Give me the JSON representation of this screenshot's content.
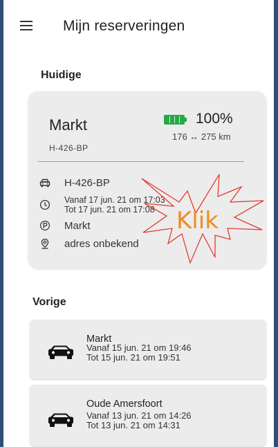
{
  "header": {
    "title": "Mijn reserveringen",
    "menu_icon": "hamburger-menu-icon"
  },
  "current": {
    "section_title": "Huidige",
    "location": "Markt",
    "plate": "H-426-BP",
    "battery_percent": "100%",
    "battery_level": 1.0,
    "battery_color": "#26a845",
    "range": "176 ↔ 275 km",
    "details": {
      "plate": "H-426-BP",
      "from": "Vanaf 17 jun. 21 om 17:03",
      "to": "Tot 17 jun. 21 om 17:08",
      "parking": "Markt",
      "address": "adres onbekend"
    },
    "annotation": "Klik",
    "annotation_color": "#f28a1e"
  },
  "previous": {
    "section_title": "Vorige",
    "items": [
      {
        "location": "Markt",
        "from": "Vanaf 15 jun. 21 om 19:46",
        "to": "Tot 15 jun. 21 om 19:51"
      },
      {
        "location": "Oude Amersfoort",
        "from": "Vanaf 13 jun. 21 om 14:26",
        "to": "Tot 13 jun. 21 om 14:31"
      }
    ]
  },
  "icons": {
    "car": "car-icon",
    "clock": "clock-icon",
    "parking": "parking-icon",
    "location": "location-pin-icon",
    "battery": "battery-icon"
  }
}
